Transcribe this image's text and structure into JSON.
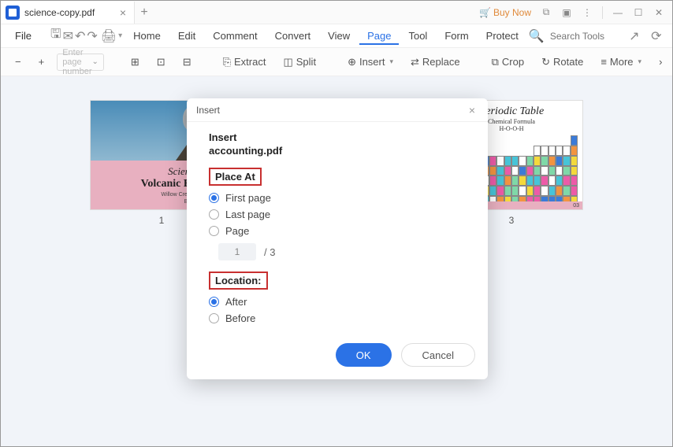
{
  "titlebar": {
    "tab_title": "science-copy.pdf",
    "buy_now": "Buy Now"
  },
  "menu": {
    "file": "File",
    "tabs": [
      "Home",
      "Edit",
      "Comment",
      "Convert",
      "View",
      "Page",
      "Tool",
      "Form",
      "Protect"
    ],
    "active_index": 5,
    "search_placeholder": "Search Tools"
  },
  "toolbar": {
    "page_placeholder": "Enter page number",
    "extract": "Extract",
    "split": "Split",
    "insert": "Insert",
    "replace": "Replace",
    "crop": "Crop",
    "rotate": "Rotate",
    "more": "More"
  },
  "thumbs": {
    "num1": "1",
    "num3": "3",
    "volcano": {
      "title": "Science Class",
      "subtitle": "Volcanic Experim",
      "school": "Willow Creek High School",
      "author": "By Brooke Wells"
    },
    "periodic": {
      "title": "Periodic Table",
      "sub1": "Chemical Formula",
      "sub2": "H-O-O-H",
      "page": "03"
    }
  },
  "modal": {
    "header": "Insert",
    "insert_label": "Insert",
    "filename": "accounting.pdf",
    "place_at": "Place At",
    "opt_first": "First page",
    "opt_last": "Last page",
    "opt_page": "Page",
    "page_value": "1",
    "page_total": "/  3",
    "location": "Location:",
    "opt_after": "After",
    "opt_before": "Before",
    "ok": "OK",
    "cancel": "Cancel"
  }
}
